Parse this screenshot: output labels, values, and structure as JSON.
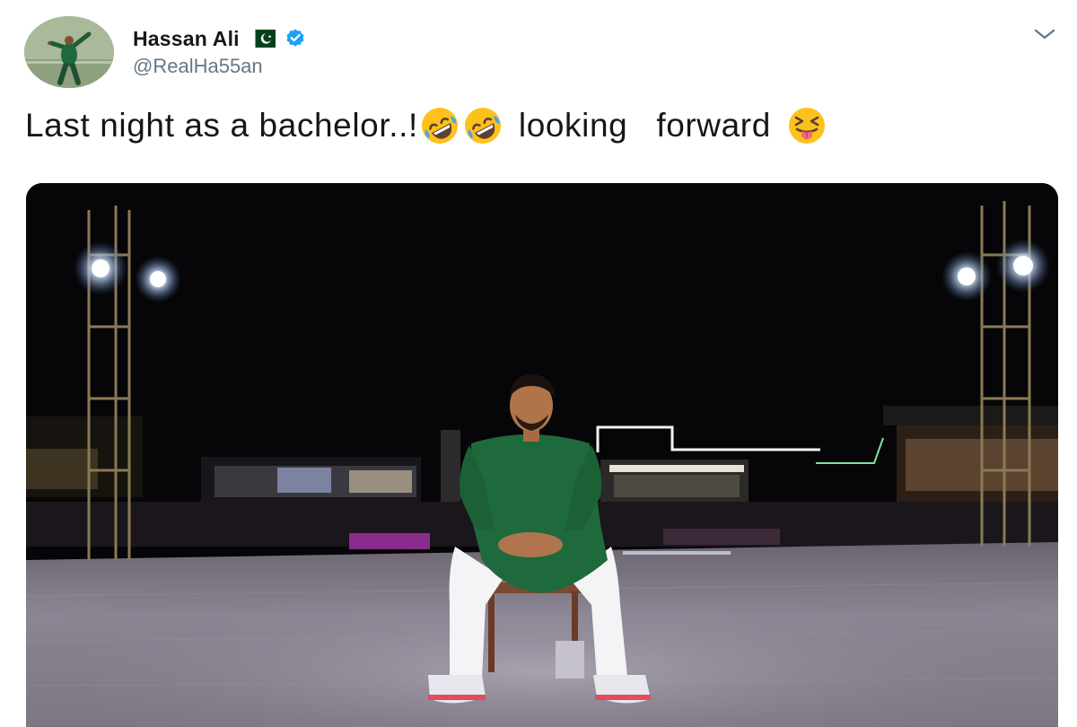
{
  "tweet": {
    "author": {
      "display_name": "Hassan Ali",
      "handle": "@RealHa55an",
      "verified": true,
      "flag_icon": "pakistan-flag-icon"
    },
    "text_part1": "Last night as a bachelor..!",
    "text_part2": "looking",
    "text_part3": "forward",
    "emojis": [
      "rolling-on-floor-laughing-emoji",
      "rolling-on-floor-laughing-emoji",
      "squinting-tongue-emoji"
    ],
    "menu_icon": "chevron-down-icon",
    "media": {
      "type": "photo"
    },
    "colors": {
      "verified_blue": "#1da1f2",
      "text": "#14171a",
      "muted": "#657786"
    }
  }
}
